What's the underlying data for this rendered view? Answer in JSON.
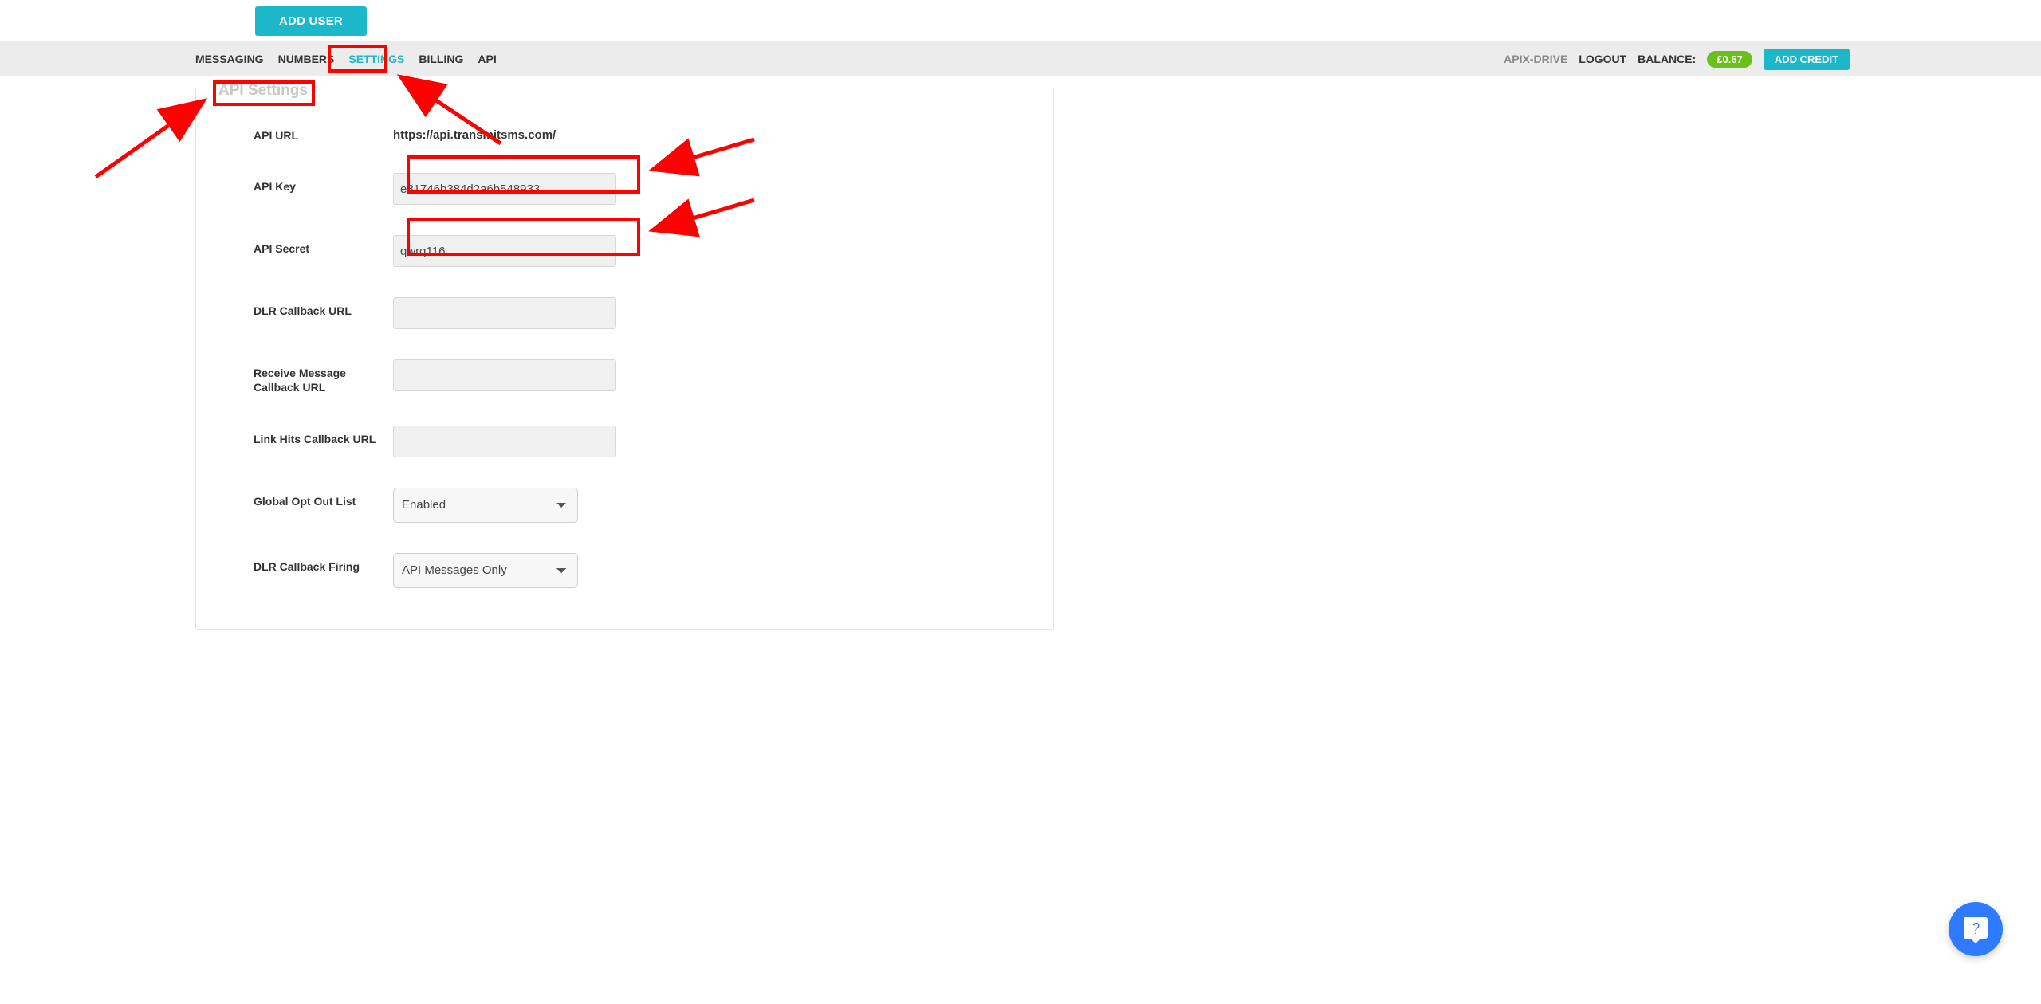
{
  "header": {
    "add_user_label": "ADD USER"
  },
  "nav": {
    "items": [
      "MESSAGING",
      "NUMBERS",
      "SETTINGS",
      "BILLING",
      "API"
    ],
    "active_index": 2,
    "username": "APIX-DRIVE",
    "logout": "LOGOUT",
    "balance_label": "BALANCE:",
    "balance_value": "£0.67",
    "add_credit_label": "ADD CREDIT"
  },
  "panel": {
    "title": "API Settings",
    "rows": {
      "api_url": {
        "label": "API URL",
        "value": "https://api.transmitsms.com/"
      },
      "api_key": {
        "label": "API Key",
        "value": "e81746b384d2a6b548933"
      },
      "api_secret": {
        "label": "API Secret",
        "value": "qwrq116"
      },
      "dlr_callback": {
        "label": "DLR Callback URL",
        "value": ""
      },
      "receive_msg": {
        "label": "Receive Message Callback URL",
        "value": ""
      },
      "link_hits": {
        "label": "Link Hits Callback URL",
        "value": ""
      },
      "global_opt_out": {
        "label": "Global Opt Out List",
        "value": "Enabled"
      },
      "dlr_firing": {
        "label": "DLR Callback Firing",
        "value": "API Messages Only"
      }
    }
  }
}
